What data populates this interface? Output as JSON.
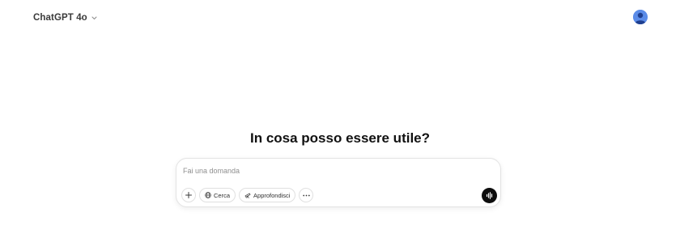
{
  "header": {
    "model_name": "ChatGPT 4o",
    "model_chevron_icon": "chevron-down-icon",
    "avatar_icon": "user-avatar-icon",
    "avatar_color": "#5b8ce8"
  },
  "main": {
    "headline": "In cosa posso essere utile?"
  },
  "composer": {
    "placeholder": "Fai una domanda",
    "value": "",
    "tools": {
      "attach_icon": "plus-icon",
      "search_label": "Cerca",
      "search_icon": "globe-icon",
      "deep_research_label": "Approfondisci",
      "deep_research_icon": "telescope-icon",
      "more_icon": "more-horizontal-icon"
    },
    "voice_icon": "voice-waveform-icon"
  }
}
